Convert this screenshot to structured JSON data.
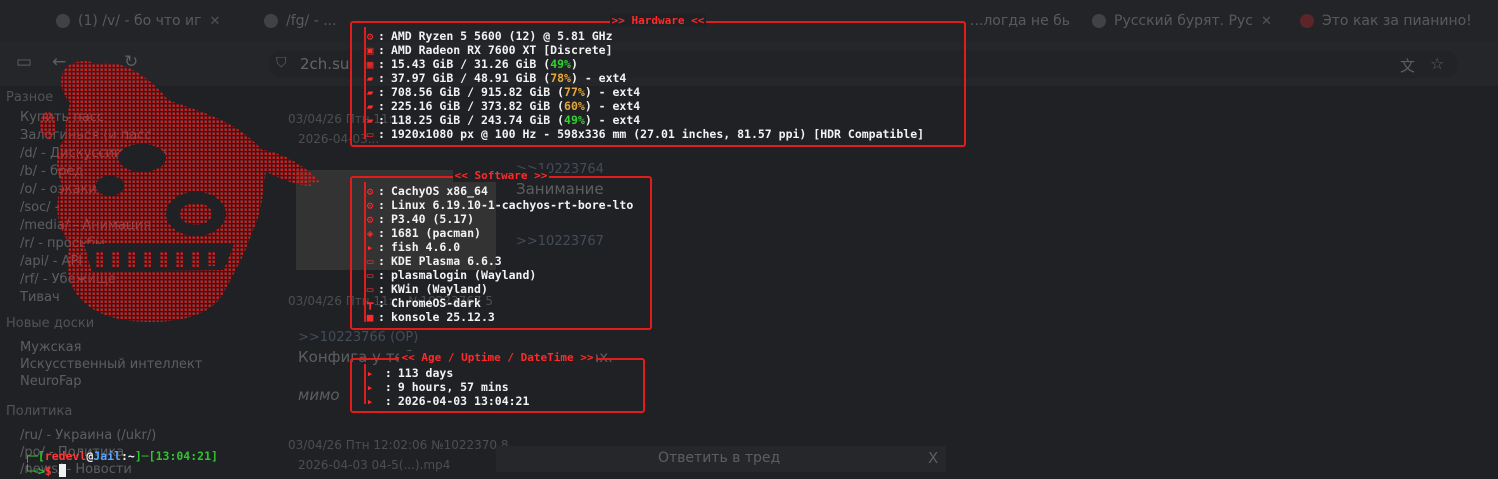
{
  "browser": {
    "tabs": [
      {
        "label": "(1) /v/ - бо что иг"
      },
      {
        "label": "/fg/ - ..."
      },
      {
        "label": "..."
      },
      {
        "label": "...логда не бы"
      },
      {
        "label": "Русский бурят. Рус"
      },
      {
        "label": "Это как за пианино!"
      }
    ],
    "url": "2ch.su",
    "sidebar": {
      "section1": "Разное",
      "section1_items": [
        "Купить пасс",
        "Залогинься (и пасс...",
        "/d/ - Дискуссии двача",
        "/b/ - бред",
        "/o/ - оэкаки",
        "/soc/ - ...",
        "/media/ - Анимация",
        "/r/ - просьбы",
        "/api/ - API",
        "/rf/ - Убежище",
        "Тивач"
      ],
      "section2": "Новые доски",
      "section2_items": [
        "Мужская",
        "Искусственный интеллект",
        "NeuroFap"
      ],
      "section3": "Политика",
      "section3_items": [
        "/ru/ - Украина (/ukr/)",
        "/po/ - Политика",
        "/news/ - Новости"
      ]
    },
    "thread": {
      "meta1": "03/04/26 Птн 11:...",
      "meta1b": "2026-04-03...",
      "link1": ">>10223764",
      "text1": "Занимание",
      "link2": ">>10223767",
      "meta2": "03/04/26 Птн 11:... №10223767 5",
      "link3": ">>10223766 (OP)",
      "text3": "Конфига у тебя нет? Какие на видосах.",
      "text4": "мимо",
      "meta3": "03/04/26 Птн 12:02:06 №1022370 8",
      "meta3b": "2026-04-03 04-5(...).mp4",
      "reply": "Ответить в тред",
      "reply_close": "X"
    }
  },
  "fastfetch": {
    "accent": "#e31b1b",
    "hardware": {
      "title": ">> Hardware <<",
      "rows": [
        {
          "icon": "cpu-icon",
          "glyph": "⚙",
          "text": "AMD Ryzen 5 5600 (12) @ 5.81 GHz"
        },
        {
          "icon": "gpu-icon",
          "glyph": "▣",
          "text": "AMD Radeon RX 7600 XT [Discrete]"
        },
        {
          "icon": "memory-icon",
          "glyph": "▦",
          "pre": "15.43 GiB / 31.26 GiB (",
          "pct": "49%",
          "pct_color": "g",
          "post": ")"
        },
        {
          "icon": "disk-icon",
          "glyph": "▰",
          "pre": "37.97 GiB / 48.91 GiB (",
          "pct": "78%",
          "pct_color": "o",
          "post": ") - ext4"
        },
        {
          "icon": "disk-icon",
          "glyph": "▰",
          "pre": "708.56 GiB / 915.82 GiB (",
          "pct": "77%",
          "pct_color": "o",
          "post": ") - ext4"
        },
        {
          "icon": "disk-icon",
          "glyph": "▰",
          "pre": "225.16 GiB / 373.82 GiB (",
          "pct": "60%",
          "pct_color": "o",
          "post": ") - ext4"
        },
        {
          "icon": "disk-icon",
          "glyph": "▰",
          "pre": "118.25 GiB / 243.74 GiB (",
          "pct": "49%",
          "pct_color": "g",
          "post": ") - ext4"
        },
        {
          "icon": "display-icon",
          "glyph": "▭",
          "text": "1920x1080 px @ 100 Hz - 598x336 mm (27.01 inches, 81.57 ppi) [HDR Compatible]"
        }
      ]
    },
    "software": {
      "title": "<< Software >>",
      "rows": [
        {
          "icon": "os-icon",
          "glyph": "⚙",
          "text": "CachyOS x86_64"
        },
        {
          "icon": "kernel-icon",
          "glyph": "⚙",
          "text": "Linux 6.19.10-1-cachyos-rt-bore-lto"
        },
        {
          "icon": "perl-icon",
          "glyph": "⚙",
          "text": "P3.40 (5.17)"
        },
        {
          "icon": "packages-icon",
          "glyph": "◈",
          "text": "1681 (pacman)"
        },
        {
          "icon": "shell-icon",
          "glyph": "▸",
          "text": "fish 4.6.0"
        },
        {
          "icon": "desktop-icon",
          "glyph": "▭",
          "text": "KDE Plasma 6.6.3"
        },
        {
          "icon": "login-manager-icon",
          "glyph": "▭",
          "text": "plasmalogin (Wayland)"
        },
        {
          "icon": "window-manager-icon",
          "glyph": "▭",
          "text": "KWin (Wayland)"
        },
        {
          "icon": "theme-icon",
          "glyph": "┳",
          "text": "ChromeOS-dark"
        },
        {
          "icon": "terminal-icon",
          "glyph": "■",
          "text": "konsole 25.12.3"
        }
      ]
    },
    "uptime": {
      "title": "<< Age / Uptime / DateTime >>",
      "rows": [
        {
          "icon": "age-icon",
          "glyph": "▸",
          "text": "113 days"
        },
        {
          "icon": "uptime-icon",
          "glyph": "▸",
          "text": "9 hours, 57 mins"
        },
        {
          "icon": "datetime-icon",
          "glyph": "▸",
          "text": "2026-04-03 13:04:21"
        }
      ]
    }
  },
  "prompt": {
    "user": "redevl",
    "at": "@",
    "host": "Jail",
    "path": ":~",
    "time": "13:04:21",
    "symbol": "$"
  }
}
